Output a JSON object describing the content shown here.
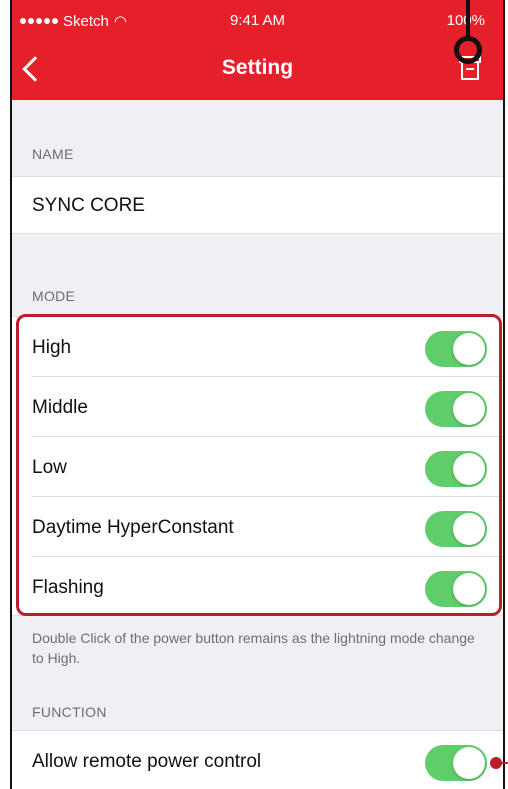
{
  "status_bar": {
    "carrier": "Sketch",
    "time": "9:41 AM",
    "battery": "100%"
  },
  "nav": {
    "title": "Setting",
    "back_icon": "chevron-left-icon",
    "action_icon": "archive-box-icon"
  },
  "name_section": {
    "header": "NAME",
    "value": "SYNC CORE"
  },
  "mode_section": {
    "header": "MODE",
    "items": [
      {
        "label": "High",
        "on": true
      },
      {
        "label": "Middle",
        "on": true
      },
      {
        "label": "Low",
        "on": true
      },
      {
        "label": "Daytime HyperConstant",
        "on": true
      },
      {
        "label": "Flashing",
        "on": true
      }
    ],
    "footnote": "Double Click of the power button remains as the lightning mode change to High."
  },
  "function_section": {
    "header": "FUNCTION",
    "items": [
      {
        "label": "Allow remote power control",
        "on": true
      }
    ]
  },
  "colors": {
    "brand_red": "#e5202b",
    "toggle_on": "#5fce6a",
    "highlight": "#b81e2b"
  }
}
